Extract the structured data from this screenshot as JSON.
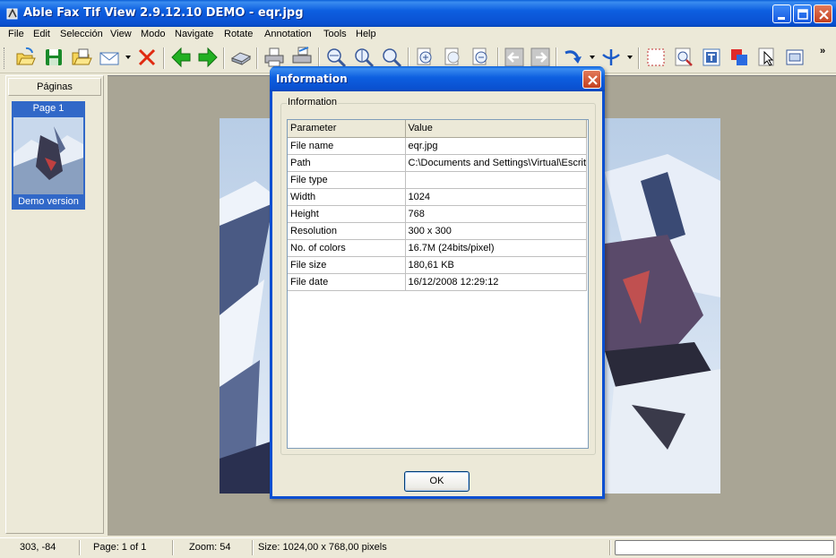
{
  "window": {
    "title": "Able Fax Tif View 2.9.12.10 DEMO  - eqr.jpg"
  },
  "menu": [
    "File",
    "Edit",
    "Selección",
    "View",
    "Modo",
    "Navigate",
    "Rotate",
    "Annotation",
    "Tools",
    "Help"
  ],
  "toolbar": {
    "buttons": [
      "open-icon",
      "save-icon",
      "open-folder-icon",
      "email-icon",
      "delete-icon",
      "previous-page-icon",
      "next-page-icon",
      "scan-icon",
      "print-icon",
      "print-setup-icon",
      "fit-width-icon",
      "fit-height-icon",
      "fit-page-icon",
      "zoom-in-icon",
      "actual-size-icon",
      "zoom-out-icon",
      "back-icon",
      "forward-icon",
      "rotate-icon",
      "flip-icon",
      "select-icon",
      "zoom-select-icon",
      "text-annotation-icon",
      "color-annotation-icon",
      "pointer-icon",
      "crop-icon"
    ],
    "overflow": "»"
  },
  "pages_panel": {
    "header": "Páginas",
    "thumb_label": "Page 1",
    "thumb_caption": "Demo version"
  },
  "dialog": {
    "title": "Information",
    "group_label": "Information",
    "columns": [
      "Parameter",
      "Value"
    ],
    "rows": [
      [
        "File name",
        "eqr.jpg"
      ],
      [
        "Path",
        "C:\\Documents and Settings\\Virtual\\Escrit"
      ],
      [
        "File type",
        ""
      ],
      [
        "Width",
        "1024"
      ],
      [
        "Height",
        "768"
      ],
      [
        "Resolution",
        "300 x 300"
      ],
      [
        "No. of colors",
        "16.7M (24bits/pixel)"
      ],
      [
        "File size",
        "180,61 KB"
      ],
      [
        "File date",
        "16/12/2008 12:29:12"
      ]
    ],
    "ok_label": "OK"
  },
  "status": {
    "coords": "303, -84",
    "page": "Page: 1 of 1",
    "zoom": "Zoom: 54",
    "size": "Size: 1024,00 x 768,00 pixels"
  }
}
